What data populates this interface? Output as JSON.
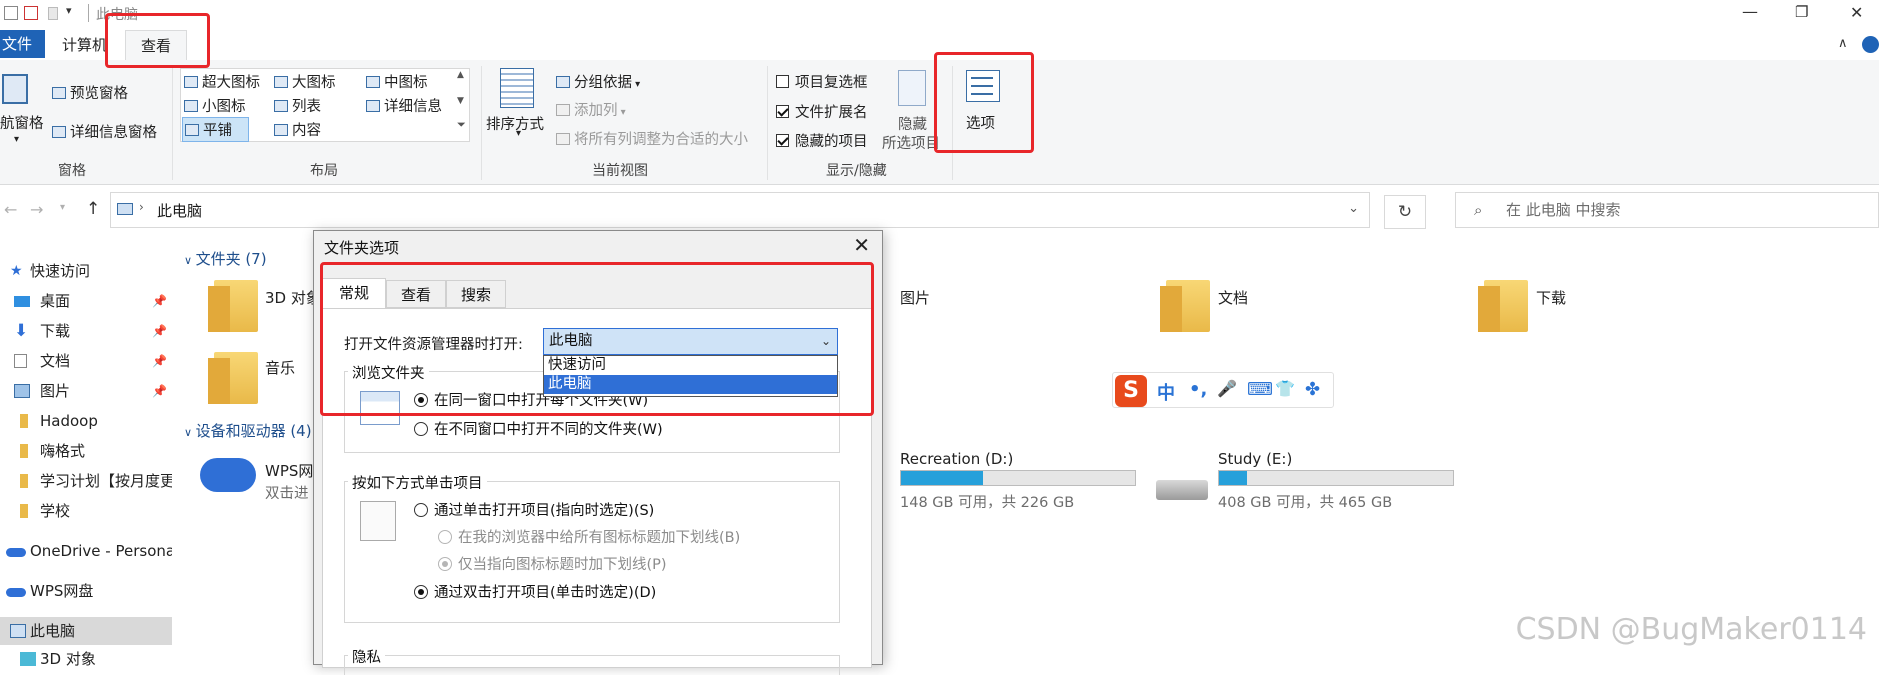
{
  "titlebar": {
    "title": "此电脑",
    "minimize": "—",
    "maximize": "❐",
    "close": "✕"
  },
  "ribbon_tabs": {
    "file": "文件",
    "computer": "计算机",
    "view": "查看"
  },
  "ribbon": {
    "pane": {
      "preview": "预览窗格",
      "nav": "航窗格",
      "details": "详细信息窗格",
      "label": "窗格"
    },
    "layout": {
      "items": [
        "超大图标",
        "大图标",
        "中图标",
        "小图标",
        "列表",
        "详细信息",
        "平铺",
        "内容"
      ],
      "label": "布局"
    },
    "current_view": {
      "sort": "排序方式",
      "group": "分组依据",
      "add_col": "添加列",
      "fit_cols": "将所有列调整为合适的大小",
      "label": "当前视图"
    },
    "show_hide": {
      "item_checkbox": "项目复选框",
      "file_ext": "文件扩展名",
      "hidden_items": "隐藏的项目",
      "hide": "隐藏",
      "hide2": "所选项目",
      "label": "显示/隐藏"
    },
    "options": {
      "label": "选项"
    }
  },
  "checkbox_states": {
    "item_checkbox": false,
    "file_ext": true,
    "hidden_items": true
  },
  "address": {
    "path": "此电脑",
    "search_placeholder": "在 此电脑 中搜索"
  },
  "sidebar": {
    "items": [
      {
        "label": "快速访问",
        "pin": false
      },
      {
        "label": "桌面",
        "pin": true
      },
      {
        "label": "下载",
        "pin": true
      },
      {
        "label": "文档",
        "pin": true
      },
      {
        "label": "图片",
        "pin": true
      },
      {
        "label": "Hadoop",
        "pin": false
      },
      {
        "label": "嗨格式",
        "pin": false
      },
      {
        "label": "学习计划【按月度更",
        "pin": false
      },
      {
        "label": "学校",
        "pin": false
      },
      {
        "label": "OneDrive - Persona",
        "pin": false
      },
      {
        "label": "WPS网盘",
        "pin": false
      },
      {
        "label": "此电脑",
        "pin": false
      },
      {
        "label": "3D 对象",
        "pin": false
      }
    ]
  },
  "content": {
    "folders_header": "文件夹 (7)",
    "folders": [
      "3D 对象",
      "图片",
      "文档",
      "下载",
      "音乐"
    ],
    "devices_header": "设备和驱动器 (4)",
    "wps": {
      "name": "WPS网",
      "sub": "双击进"
    },
    "drives": [
      {
        "name": "Recreation (D:)",
        "info": "148 GB 可用，共 226 GB",
        "used_fraction": 0.35
      },
      {
        "name": "Study (E:)",
        "info": "408 GB 可用，共 465 GB",
        "used_fraction": 0.12
      }
    ]
  },
  "dialog": {
    "title": "文件夹选项",
    "close": "✕",
    "tabs": [
      "常规",
      "查看",
      "搜索"
    ],
    "open_label": "打开文件资源管理器时打开:",
    "open_value": "此电脑",
    "open_options": [
      "快速访问",
      "此电脑"
    ],
    "browse": {
      "title": "浏览文件夹",
      "opt1": "在同一窗口中打开每个文件夹(W)",
      "opt2": "在不同窗口中打开不同的文件夹(W)"
    },
    "click": {
      "title": "按如下方式单击项目",
      "opt1": "通过单击打开项目(指向时选定)(S)",
      "sub1": "在我的浏览器中给所有图标标题加下划线(B)",
      "sub2": "仅当指向图标标题时加下划线(P)",
      "opt2": "通过双击打开项目(单击时选定)(D)"
    },
    "privacy": "隐私"
  },
  "ime": {
    "logo": "S",
    "items": [
      "中",
      "•,",
      "🎤",
      "⌨",
      "👕",
      "✤"
    ]
  },
  "watermark": "CSDN @BugMaker0114"
}
